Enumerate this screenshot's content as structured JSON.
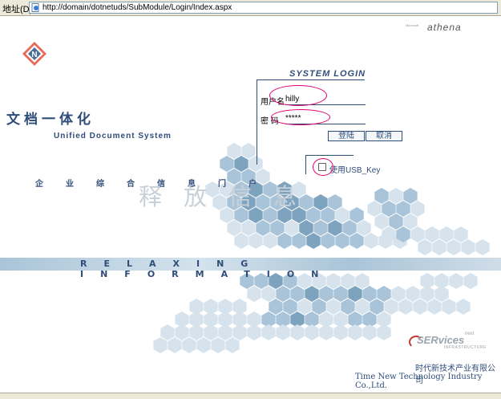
{
  "addressbar": {
    "label": "地址(D)",
    "url": "http://domain/dotnetuds/SubModule/Login/Index.aspx"
  },
  "brand": {
    "athena": "athena",
    "title_cn": "文档一体化",
    "title_en": "Unified Document System",
    "portal": "企业综合信息门户",
    "release": "释放信息",
    "band_text": "RELAXING INFORMATION"
  },
  "login": {
    "heading": "SYSTEM LOGIN",
    "username_label": "用户名",
    "username_value": "hilly",
    "password_label": "密 码",
    "password_value": "*****",
    "login_button": "登陆",
    "cancel_button": "取消",
    "usb_label": "使用USB_Key",
    "usb_checked": false
  },
  "footer": {
    "services": "SERvices",
    "company_cn": "时代新技术产业有限公司",
    "company_en": "Time New Technology Industry Co.,Ltd."
  },
  "colors": {
    "accent": "#2f4d7a",
    "hex_dark": "#7ea3bf",
    "hex_mid": "#a9c4d8",
    "hex_light": "#d6e3ec",
    "highlight": "#e0006e"
  }
}
